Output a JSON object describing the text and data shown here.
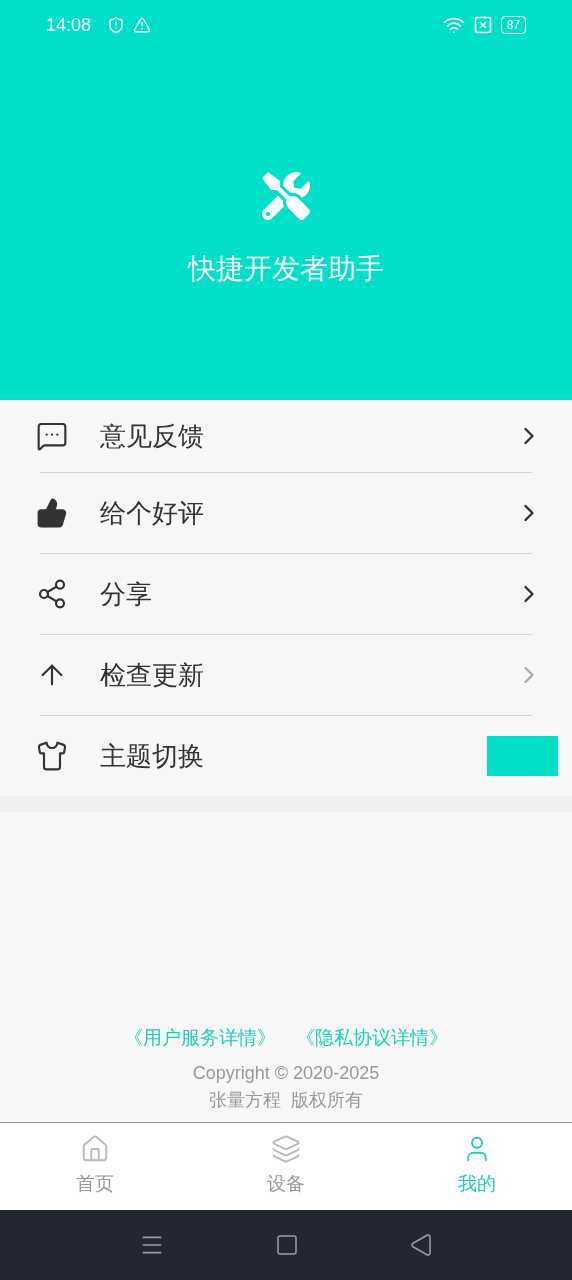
{
  "status_bar": {
    "time": "14:08",
    "battery": "87"
  },
  "header": {
    "title": "快捷开发者助手"
  },
  "menu": [
    {
      "kind": "chevron",
      "label": "意见反馈",
      "disabled": false
    },
    {
      "kind": "chevron",
      "label": "给个好评",
      "disabled": false
    },
    {
      "kind": "chevron",
      "label": "分享",
      "disabled": false
    },
    {
      "kind": "chevron",
      "label": "检查更新",
      "disabled": true
    },
    {
      "kind": "swatch",
      "label": "主题切换",
      "color": "#00e0c6"
    }
  ],
  "footer": {
    "links": [
      "《用户服务详情》",
      "《隐私协议详情》"
    ],
    "copyright": "Copyright © 2020-2025",
    "owner": "张量方程  版权所有"
  },
  "tab_bar": [
    {
      "label": "首页",
      "selected": false
    },
    {
      "label": "设备",
      "selected": false
    },
    {
      "label": "我的",
      "selected": true
    }
  ]
}
